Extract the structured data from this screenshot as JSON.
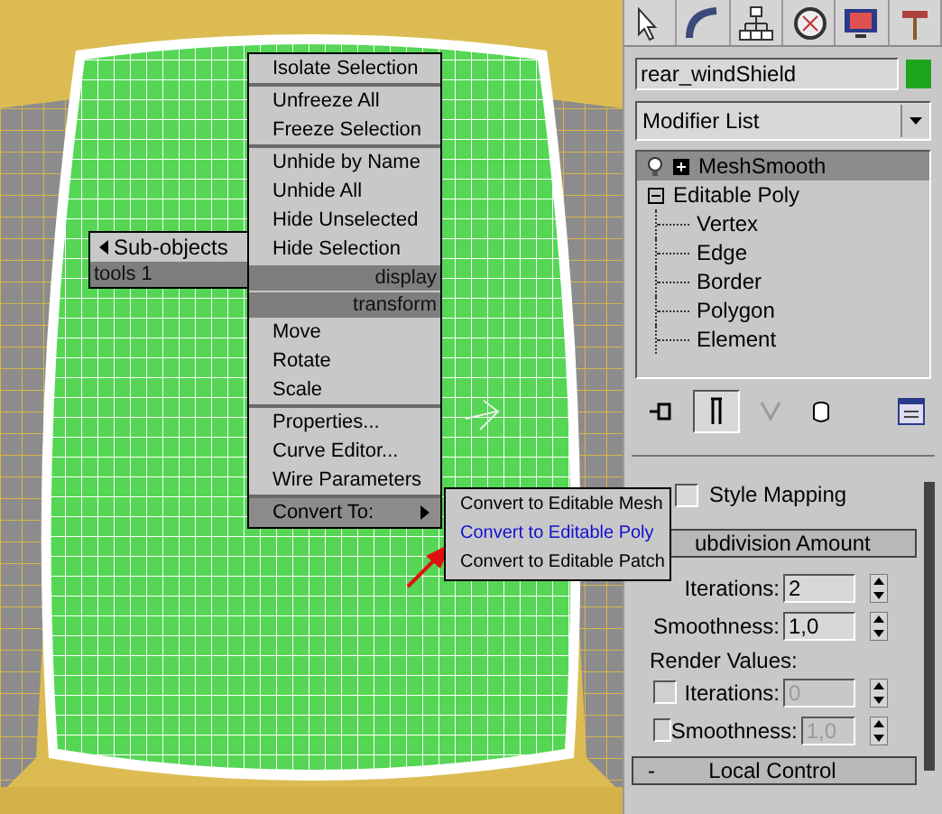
{
  "quad_menu": {
    "upper_left": {
      "title": "tools 1",
      "items": [
        {
          "label": "Sub-objects",
          "submenu": true,
          "selected": false
        }
      ]
    },
    "upper_right": {
      "title": "display",
      "groups": [
        [
          {
            "label": "Isolate Selection",
            "submenu": false,
            "selected": false
          }
        ],
        [
          {
            "label": "Unfreeze All",
            "submenu": false,
            "selected": false
          },
          {
            "label": "Freeze Selection",
            "submenu": false,
            "selected": false
          }
        ],
        [
          {
            "label": "Unhide by Name",
            "submenu": false,
            "selected": false
          },
          {
            "label": "Unhide All",
            "submenu": false,
            "selected": false
          },
          {
            "label": "Hide Unselected",
            "submenu": false,
            "selected": false
          },
          {
            "label": "Hide Selection",
            "submenu": false,
            "selected": false
          }
        ]
      ]
    },
    "lower_right": {
      "title": "transform",
      "groups": [
        [
          {
            "label": "Move",
            "submenu": false,
            "selected": false
          },
          {
            "label": "Rotate",
            "submenu": false,
            "selected": false
          },
          {
            "label": "Scale",
            "submenu": false,
            "selected": false
          }
        ],
        [
          {
            "label": "Properties...",
            "submenu": false,
            "selected": false
          },
          {
            "label": "Curve Editor...",
            "submenu": false,
            "selected": false
          },
          {
            "label": "Wire Parameters",
            "submenu": false,
            "selected": false
          }
        ],
        [
          {
            "label": "Convert To:",
            "submenu": true,
            "selected": true
          }
        ]
      ]
    },
    "submenu": [
      {
        "label": "Convert to Editable Mesh",
        "selected": false
      },
      {
        "label": "Convert to Editable Poly",
        "selected": true
      },
      {
        "label": "Convert to Editable Patch",
        "selected": false
      }
    ]
  },
  "command_panel": {
    "object_name": {
      "value": "rear_windShield",
      "color": "#1ea51e"
    },
    "modifier_list": {
      "value": "Modifier List"
    },
    "modifier_stack": [
      {
        "label": "MeshSmooth",
        "selected": true,
        "expanded": false
      },
      {
        "label": "Editable Poly",
        "selected": false,
        "expanded": true,
        "children": [
          {
            "label": "Vertex",
            "selected": false
          },
          {
            "label": "Edge",
            "selected": false
          },
          {
            "label": "Border",
            "selected": false
          },
          {
            "label": "Polygon",
            "selected": false
          },
          {
            "label": "Element",
            "selected": false
          }
        ]
      }
    ],
    "show_end_result": {
      "on": true
    },
    "rollout": [
      {
        "kind": "checkbox",
        "label": "Style Mapping",
        "checked": false
      },
      {
        "kind": "header",
        "label": "ubdivision Amount"
      },
      {
        "kind": "spinner",
        "label": "Iterations:",
        "value": "2",
        "disabled": false
      },
      {
        "kind": "spinner",
        "label": "Smoothness:",
        "value": "1,0",
        "disabled": false
      },
      {
        "kind": "label",
        "label": "Render Values:"
      },
      {
        "kind": "checkspinner",
        "label": "Iterations:",
        "value": "0",
        "checked": false,
        "disabled": true
      },
      {
        "kind": "checkspinner",
        "label": "Smoothness:",
        "value": "1,0",
        "checked": false,
        "disabled": true
      },
      {
        "kind": "header",
        "label": "Local Control",
        "sign": "-"
      }
    ]
  }
}
